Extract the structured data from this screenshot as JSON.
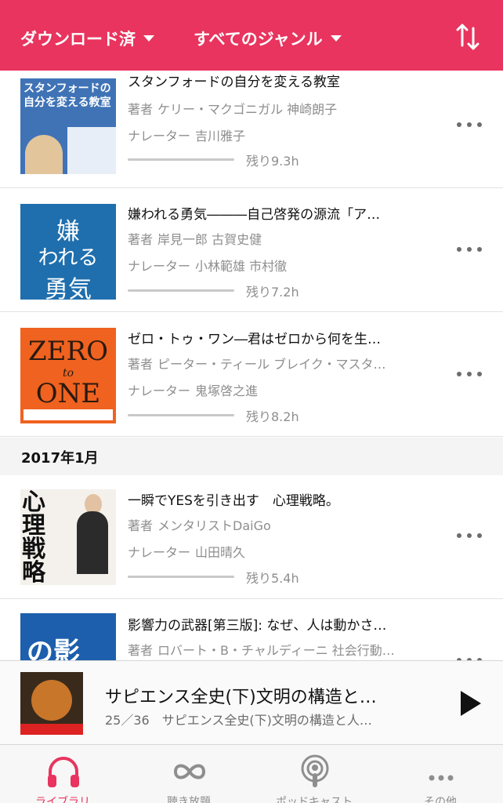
{
  "header": {
    "filter_download": "ダウンロード済",
    "filter_genre": "すべてのジャンル",
    "sort_icon": "sort-arrows-icon",
    "color": "#e8345e"
  },
  "items": [
    {
      "title": "スタンフォードの自分を変える教室",
      "author_key": "著者",
      "authors": "ケリー・マクゴニガル 神崎朗子",
      "narrator_key": "ナレーター",
      "narrators": "吉川雅子",
      "remaining": "残り9.3h",
      "cover_text": "スタンフォードの\n自分を変える教室"
    },
    {
      "title": "嫌われる勇気―――自己啓発の源流「ア…",
      "author_key": "著者",
      "authors": "岸見一郎 古賀史健",
      "narrator_key": "ナレーター",
      "narrators": "小林範雄 市村徹",
      "remaining": "残り7.2h",
      "cover_text_1": "嫌",
      "cover_text_2": "われる",
      "cover_text_3": "勇気"
    },
    {
      "title": "ゼロ・トゥ・ワン―君はゼロから何を生…",
      "author_key": "著者",
      "authors": "ピーター・ティール ブレイク・マスタ…",
      "narrator_key": "ナレーター",
      "narrators": "鬼塚啓之進",
      "remaining": "残り8.2h",
      "cover_text_1": "ZERO",
      "cover_text_2": "to",
      "cover_text_3": "ONE"
    }
  ],
  "section": {
    "label": "2017年1月"
  },
  "items2": [
    {
      "title": "一瞬でYESを引き出す　心理戦略。",
      "author_key": "著者",
      "authors": "メンタリストDaiGo",
      "narrator_key": "ナレーター",
      "narrators": "山田晴久",
      "remaining": "残り5.4h",
      "cover_text": "心理戦略"
    },
    {
      "title": "影響力の武器[第三版]: なぜ、人は動かさ…",
      "author_key": "著者",
      "authors": "ロバート・B・チャルディーニ 社会行動…",
      "cover_text": "の影"
    }
  ],
  "player": {
    "title": "サピエンス全史(下)文明の構造と…",
    "subtitle": "25／36　サピエンス全史(下)文明の構造と人…",
    "play_icon": "play-icon"
  },
  "tabs": [
    {
      "label": "ライブラリ",
      "icon": "headphones-icon",
      "active": true
    },
    {
      "label": "聴き放題",
      "icon": "infinity-icon",
      "active": false
    },
    {
      "label": "ポッドキャスト",
      "icon": "podcast-icon",
      "active": false
    },
    {
      "label": "その他",
      "icon": "more-icon",
      "active": false
    }
  ]
}
